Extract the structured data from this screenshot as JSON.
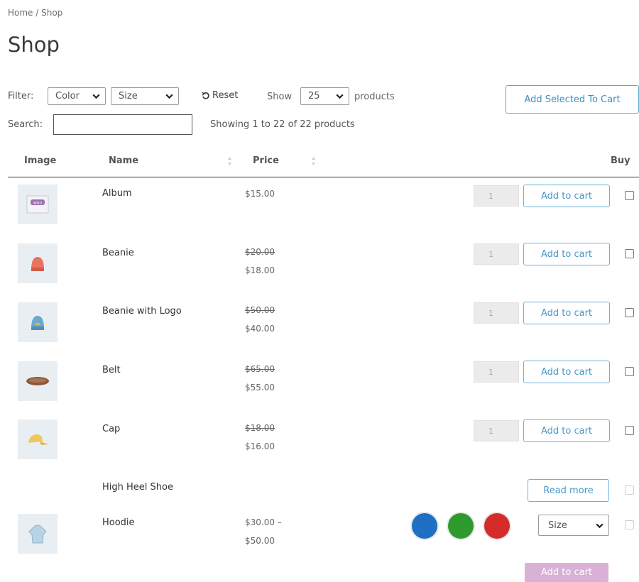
{
  "breadcrumb": "Home / Shop",
  "page_title": "Shop",
  "filter": {
    "label": "Filter:",
    "color_select": "Color",
    "size_select": "Size",
    "reset_label": "Reset",
    "show_label": "Show",
    "per_page_value": "25",
    "products_label": "products"
  },
  "add_selected_label": "Add Selected To Cart",
  "search": {
    "label": "Search:",
    "value": ""
  },
  "showing_text": "Showing 1 to 22 of 22 products",
  "table": {
    "headers": {
      "image": "Image",
      "name": "Name",
      "price": "Price",
      "buy": "Buy"
    },
    "rows": [
      {
        "name": "Album",
        "price": "$15.00",
        "qty": "1",
        "action": "Add to cart",
        "icon": "album-image"
      },
      {
        "name": "Beanie",
        "old_price": "$20.00",
        "price": "$18.00",
        "qty": "1",
        "action": "Add to cart",
        "icon": "beanie-image"
      },
      {
        "name": "Beanie with Logo",
        "old_price": "$50.00",
        "price": "$40.00",
        "qty": "1",
        "action": "Add to cart",
        "icon": "beanie-logo-image"
      },
      {
        "name": "Belt",
        "old_price": "$65.00",
        "price": "$55.00",
        "qty": "1",
        "action": "Add to cart",
        "icon": "belt-image"
      },
      {
        "name": "Cap",
        "old_price": "$18.00",
        "price": "$16.00",
        "qty": "1",
        "action": "Add to cart",
        "icon": "cap-image"
      },
      {
        "name": "High Heel Shoe",
        "action": "Read more"
      },
      {
        "name": "Hoodie",
        "price_range_from": "$30.00 –",
        "price_range_to": "$50.00",
        "size_select": "Size",
        "icon": "hoodie-image",
        "swatches": [
          "#1f6fc5",
          "#2e9a2e",
          "#d62b2b"
        ],
        "action": "Add to cart"
      }
    ]
  },
  "colors": {
    "accent": "#4a98c8",
    "disabled_button": "#d9b1d6"
  }
}
